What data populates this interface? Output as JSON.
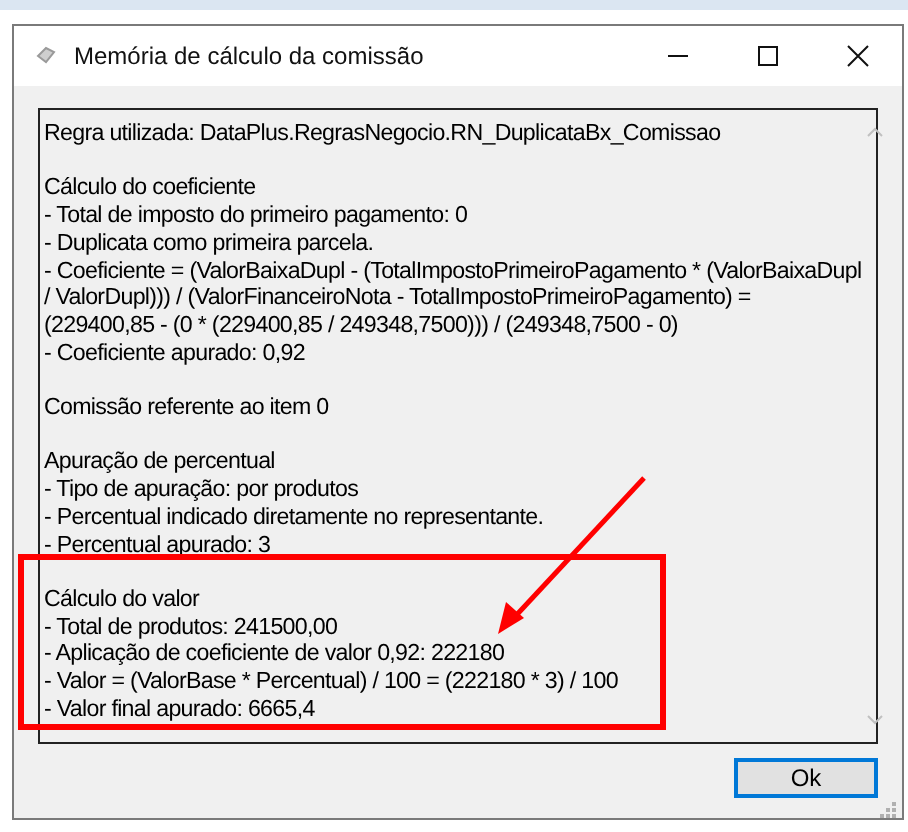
{
  "window": {
    "title": "Memória de cálculo da comissão"
  },
  "memo": {
    "paragraphs": [
      [
        "Regra utilizada: DataPlus.RegrasNegocio.RN_DuplicataBx_Comissao"
      ],
      [
        "Cálculo do coeficiente",
        "- Total de imposto do primeiro pagamento: 0",
        "- Duplicata como primeira parcela.",
        "- Coeficiente = (ValorBaixaDupl - (TotalImpostoPrimeiroPagamento * (ValorBaixaDupl",
        "/ ValorDupl))) / (ValorFinanceiroNota - TotalImpostoPrimeiroPagamento) =",
        "(229400,85 - (0 * (229400,85 / 249348,7500))) / (249348,7500 - 0)",
        "- Coeficiente apurado: 0,92"
      ],
      [
        "Comissão referente ao item 0"
      ],
      [
        "Apuração de percentual",
        "- Tipo de apuração: por produtos",
        "- Percentual indicado diretamente no representante.",
        "- Percentual apurado: 3"
      ],
      [
        "Cálculo do valor",
        "- Total de produtos: 241500,00",
        "- Aplicação de coeficiente de valor 0,92: 222180",
        "- Valor = (ValorBase * Percentual) / 100 = (222180 * 3) / 100",
        "- Valor final apurado: 6665,4"
      ]
    ]
  },
  "buttons": [
    "Ok"
  ]
}
